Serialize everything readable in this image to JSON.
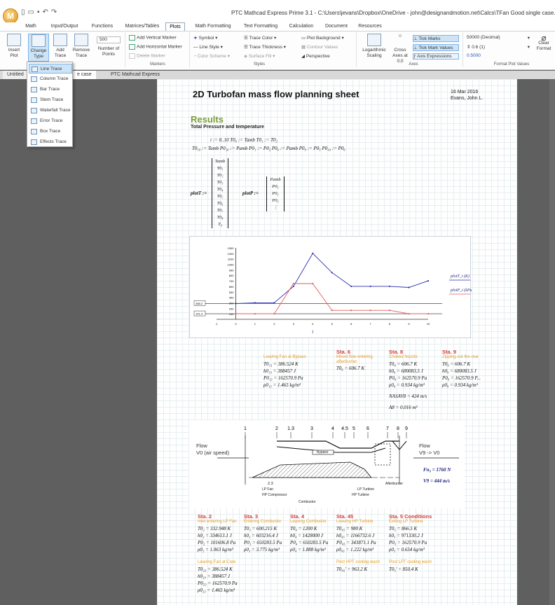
{
  "window": {
    "title": "PTC Mathcad Express Prime 3.1 - C:\\Users\\jevans\\Dropbox\\OneDrive - john@designandmotion.net\\Calcs\\TFan Good single case.mcdx",
    "logo": "M"
  },
  "tabs": [
    "Math",
    "Input/Output",
    "Functions",
    "Matrices/Tables",
    "Plots",
    "Math Formatting",
    "Text Formatting",
    "Calculation",
    "Document",
    "Resources"
  ],
  "active_tab": "Plots",
  "ribbon": {
    "insert_plot": "Insert Plot",
    "change_type": "Change Type",
    "add_trace": "Add Trace",
    "remove_trace": "Remove Trace",
    "points_value": "500",
    "number_of_points": "Number of Points",
    "add_vertical_marker": "Add Vertical Marker",
    "add_horizontal_marker": "Add Horizontal Marker",
    "delete_marker": "Delete Marker",
    "symbol": "Symbol",
    "line_style": "Line Style",
    "color_scheme": "Color Scheme",
    "trace_color": "Trace Color",
    "trace_thickness": "Trace Thickness",
    "surface_fill": "Surface Fill",
    "plot_background": "Plot Background",
    "contour_values": "Contour Values",
    "perspective": "Perspective",
    "log_scaling": "Logarithmic Scaling",
    "cross_axes": "Cross Axes at 0,0",
    "tick_marks": "Tick Marks",
    "tick_mark_values": "Tick Mark Values",
    "axis_expressions": "Axis Expressions",
    "format_value": "50000 (Decimal)",
    "precision_value": "0.6 (1)",
    "sample_value": "0.5000",
    "clear_format": "Clear Format",
    "groups": {
      "traces": "Traces",
      "markers": "Markers",
      "styles": "Styles",
      "axes": "Axes",
      "format": "Format Plot Values"
    }
  },
  "doc_tabs": [
    "Untitled",
    "e case",
    "PTC Mathcad Express"
  ],
  "change_type_menu": [
    "Line Trace",
    "Column Trace",
    "Bar Trace",
    "Stem Trace",
    "Waterfall Trace",
    "Error Trace",
    "Box Trace",
    "Effects Trace"
  ],
  "doc": {
    "title": "2D Turbofan mass flow planning sheet",
    "date": "16 Mar 2016",
    "author": "Evans, John L.",
    "results": "Results",
    "subheading": "Total Pressure and temperature",
    "def1": "i := 0..10   T0₀ := Tamb   T0₁ := T0₂",
    "def2": "T0₁₀ := Tamb   P0₁₀ := Pamb   P0₁ := P0₂   P0₀ := Pamb   P0₉ := P0₅   P0₁₀ := P0₆",
    "plotT_label": "plotT :=",
    "plotT_vector": [
      "Tamb",
      "T0₁",
      "T0₂",
      "T0₃",
      "T0₄",
      "T0₅",
      "T0₆",
      "T0₇",
      "T0₈",
      "T₉"
    ],
    "plotP_label": "plotP :=",
    "plotP_vector": [
      "Pamb",
      "P0₁",
      "P0₂",
      "P0₃",
      "⋮"
    ]
  },
  "chart_data": {
    "type": "line",
    "x": [
      0,
      1,
      2,
      3,
      4,
      5,
      6,
      7,
      8,
      9,
      10
    ],
    "series": [
      {
        "name": "plotT_i (K)",
        "values": [
          288,
          300,
          300,
          600,
          1200,
          850,
          600,
          600,
          600,
          580,
          700
        ],
        "color": "#2a2fb0"
      },
      {
        "name": "plotP_i (kPa)",
        "values": [
          101,
          101,
          101,
          650,
          650,
          163,
          163,
          163,
          163,
          101,
          101
        ],
        "color": "#e35a5a"
      }
    ],
    "xlabel": "i",
    "ylim": [
      0,
      1300
    ],
    "xlim": [
      -1,
      10
    ],
    "yticks": [
      100,
      200,
      300,
      400,
      500,
      600,
      700,
      800,
      900,
      1000,
      1100,
      1200,
      1300
    ],
    "xticks": [
      -1,
      0,
      1,
      2,
      3,
      4,
      5,
      6,
      7,
      8,
      9,
      10
    ],
    "markers": [
      "288.2",
      "101.3"
    ],
    "legend": [
      "plotT_i (K)",
      "plotP_i (kPa)"
    ],
    "legend_position": "right"
  },
  "stations_top": [
    {
      "title": "",
      "sub": "Leaving Fan at Bypass",
      "eqs": [
        "T0₁₃ = 386.524 K",
        "h0₁₃ = 388457 J",
        "P0₁₃ = 162570.9 Pa",
        "ρ0₁₃ = 1.465 kg/m³"
      ]
    },
    {
      "title": "Sta. 6",
      "sub": "Mixed flow entering afterburner",
      "eqs": [
        "T0₆ = 606.7 K"
      ]
    },
    {
      "title": "Sta. 8",
      "sub": "Choked Nozzle",
      "eqs": [
        "T0₈ = 606.7 K",
        "h0₈ = 680083.5 J",
        "P0₈ = 162570.9 Pa",
        "ρ0₈ = 0.934 kg/m³",
        "NASAV8 = 424 m/s",
        "A8 = 0.016 m²"
      ]
    },
    {
      "title": "Sta. 9",
      "sub": "Zipping out the rear",
      "eqs": [
        "T0₉ = 606.7 K",
        "h0₉ = 680083.5 J",
        "P0₉ = 162570.9 P...",
        "ρ0₉ = 0.934 kg/m³"
      ]
    }
  ],
  "engine": {
    "stations": [
      "1",
      "2",
      "1.3",
      "3",
      "4",
      "4.5",
      "5",
      "6",
      "7",
      "8",
      "9"
    ],
    "flow_left": "Flow",
    "v0": "V0 (air speed)",
    "flow_right": "Flow",
    "v9": "V9 -> V0",
    "bypass": "Bypass",
    "lp_fan": "LP Fan",
    "hp_comp": "HP Compressor",
    "combustor": "Combustor",
    "lp_turbine": "LP Turbine",
    "hp_turbine": "HP Turbine",
    "afterburner": "Afterburner",
    "st23": "2.3",
    "fn": "Fn₉ = 1760 N",
    "v9val": "V9 = 444 m/s"
  },
  "stations_bottom": [
    {
      "title": "Sta. 2",
      "sub": "Inlet entering LP Fan",
      "eqs": [
        "T0₂ = 332.948 K",
        "h0₂ = 334613.1 J",
        "P0₂ = 101606.8 Pa",
        "ρ0₂ = 1.063 kg/m³"
      ],
      "sub2": "Leaving Fan at Core",
      "eqs2": [
        "T0₂₃ = 386.524 K",
        "h0₂₃ = 388457 J",
        "P0₂₃ = 162570.9 Pa",
        "ρ0₂₃ = 1.465 kg/m³"
      ]
    },
    {
      "title": "Sta. 3",
      "sub": "Entering Combustor",
      "eqs": [
        "T0₃ = 600.215 K",
        "h0₃ = 603216.4 J",
        "P0₃ = 650283.5 Pa",
        "ρ0₃ = 3.775 kg/m³"
      ]
    },
    {
      "title": "Sta. 4",
      "sub": "Leaving Combustor",
      "eqs": [
        "T0₄ = 1200 K",
        "h0₄ = 1428000 J",
        "P0₄ = 650283.5 Pa",
        "ρ0₄ = 1.888 kg/m³"
      ]
    },
    {
      "title": "Sta. 45",
      "sub": "Leaving HP Turbine",
      "eqs": [
        "T0₄₅ = 980 K",
        "h0₄₅ = 1166732.6 J",
        "P0₄₅ = 343871.1 Pa",
        "ρ0₄₅ = 1.222 kg/m³"
      ],
      "sub2": "Post HPT cooling wash",
      "eqs2": [
        "T0₄₅' = 963.2 K"
      ]
    },
    {
      "title": "Sta. 5 Conditions",
      "sub": "Exiting LP Turbine",
      "eqs": [
        "T0₅ = 866.5 K",
        "h0₅ = 971330.2 J",
        "P0₅ = 162570.9 Pa",
        "ρ0₅ = 0.654 kg/m³"
      ],
      "sub2": "Post LPT cooling wash",
      "eqs2": [
        "T0₅' = 850.4 K"
      ]
    }
  ]
}
